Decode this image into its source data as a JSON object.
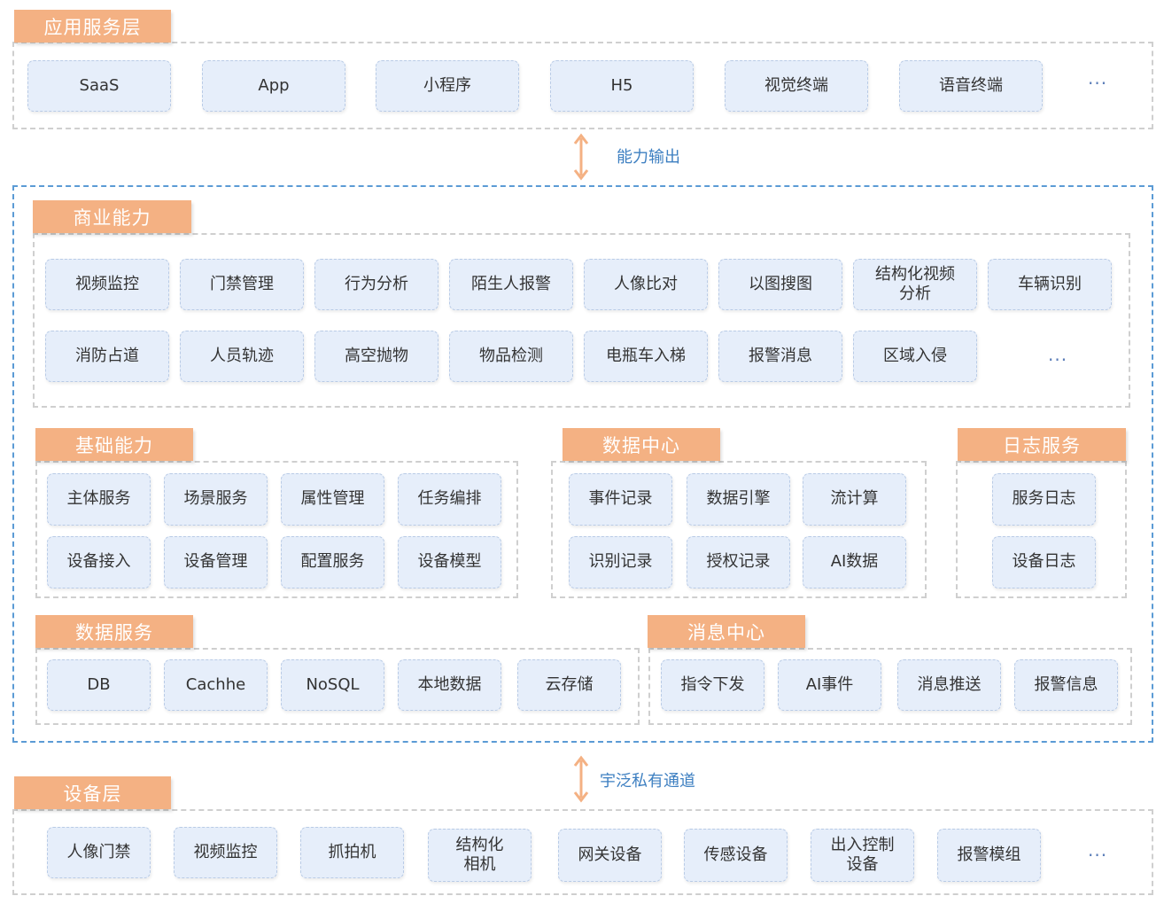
{
  "app_layer": {
    "label": "应用服务层",
    "items": [
      "SaaS",
      "App",
      "小程序",
      "H5",
      "视觉终端",
      "语音终端"
    ],
    "more": "···"
  },
  "capability_output": "能力输出",
  "business": {
    "label": "商业能力",
    "row1": [
      "视频监控",
      "门禁管理",
      "行为分析",
      "陌生人报警",
      "人像比对",
      "以图搜图",
      "结构化视频\n分析",
      "车辆识别"
    ],
    "row2": [
      "消防占道",
      "人员轨迹",
      "高空抛物",
      "物品检测",
      "电瓶车入梯",
      "报警消息",
      "区域入侵"
    ],
    "more": "···"
  },
  "basic": {
    "label": "基础能力",
    "items": [
      "主体服务",
      "场景服务",
      "属性管理",
      "任务编排",
      "设备接入",
      "设备管理",
      "配置服务",
      "设备模型"
    ]
  },
  "data_center": {
    "label": "数据中心",
    "items": [
      "事件记录",
      "数据引擎",
      "流计算",
      "识别记录",
      "授权记录",
      "AI数据"
    ]
  },
  "log_service": {
    "label": "日志服务",
    "items": [
      "服务日志",
      "设备日志"
    ]
  },
  "data_service": {
    "label": "数据服务",
    "items": [
      "DB",
      "Cachhe",
      "NoSQL",
      "本地数据",
      "云存储"
    ]
  },
  "message_center": {
    "label": "消息中心",
    "items": [
      "指令下发",
      "AI事件",
      "消息推送",
      "报警信息"
    ]
  },
  "private_channel": "宇泛私有通道",
  "device_layer": {
    "label": "设备层",
    "items": [
      "人像门禁",
      "视频监控",
      "抓拍机",
      "结构化\n相机",
      "网关设备",
      "传感设备",
      "出入控制\n设备",
      "报警模组"
    ],
    "more": "···"
  },
  "colors": {
    "label_bg": "#f4b183",
    "pill_bg": "#e6eefa",
    "outer_border": "#5b9bd5",
    "arrow": "#f4b183",
    "link_text": "#3d7fc1"
  }
}
